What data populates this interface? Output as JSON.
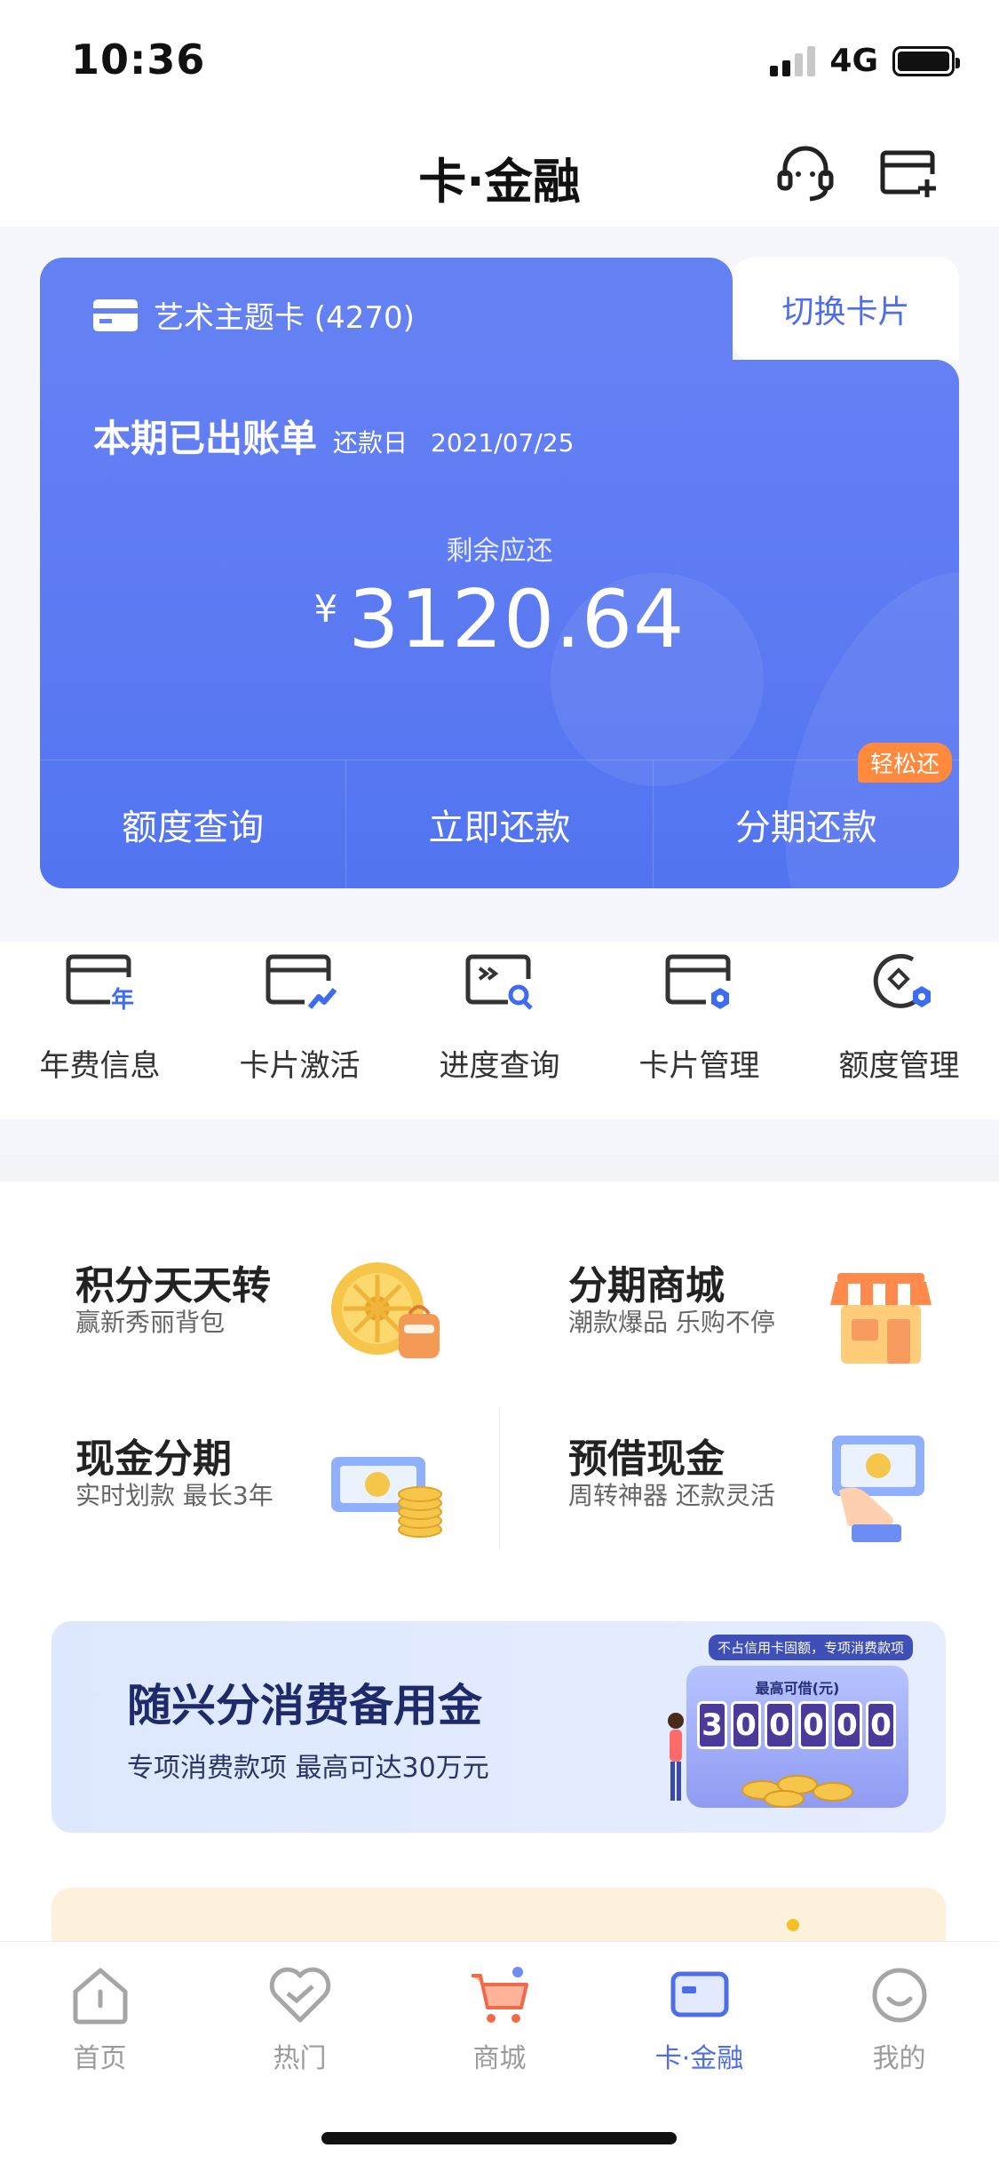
{
  "status_bar": {
    "time": "10:36",
    "network": "4G"
  },
  "nav": {
    "title": "卡·金融",
    "service_icon": "headset-icon",
    "add_card_icon": "add-card-icon"
  },
  "card": {
    "name": "艺术主题卡 (4270)",
    "switch_label": "切换卡片",
    "bill_title": "本期已出账单",
    "due_label": "还款日",
    "due_date": "2021/07/25",
    "remaining_label": "剩余应还",
    "currency": "¥",
    "amount": "3120.64",
    "actions": [
      {
        "label": "额度查询"
      },
      {
        "label": "立即还款"
      },
      {
        "label": "分期还款",
        "badge": "轻松还"
      }
    ]
  },
  "quick_actions": [
    {
      "label": "年费信息",
      "icon": "annual-fee-icon",
      "icon_text": "年"
    },
    {
      "label": "卡片激活",
      "icon": "card-activate-icon"
    },
    {
      "label": "进度查询",
      "icon": "progress-search-icon"
    },
    {
      "label": "卡片管理",
      "icon": "card-manage-icon"
    },
    {
      "label": "额度管理",
      "icon": "limit-manage-icon"
    }
  ],
  "services": [
    {
      "title": "积分天天转",
      "subtitle": "赢新秀丽背包",
      "icon": "points-wheel-icon"
    },
    {
      "title": "分期商城",
      "subtitle": "潮款爆品 乐购不停",
      "icon": "shop-icon"
    },
    {
      "title": "现金分期",
      "subtitle": "实时划款 最长3年",
      "icon": "cash-coins-icon"
    },
    {
      "title": "预借现金",
      "subtitle": "周转神器 还款灵活",
      "icon": "hand-cash-icon"
    }
  ],
  "banner": {
    "title": "随兴分消费备用金",
    "subtitle": "专项消费款项 最高可达30万元",
    "tag": "不占信用卡固额，专项消费款项",
    "machine_label": "最高可借(元)",
    "digits": [
      "3",
      "0",
      "0",
      "0",
      "0",
      "0"
    ]
  },
  "tabs": [
    {
      "label": "首页",
      "icon": "home-icon"
    },
    {
      "label": "热门",
      "icon": "heart-icon"
    },
    {
      "label": "商城",
      "icon": "cart-icon"
    },
    {
      "label": "卡·金融",
      "icon": "card-finance-icon",
      "active": true
    },
    {
      "label": "我的",
      "icon": "profile-icon"
    }
  ],
  "colors": {
    "accent": "#4d6ee8",
    "card": "#5a78f2",
    "badge": "#ff8a3d"
  }
}
